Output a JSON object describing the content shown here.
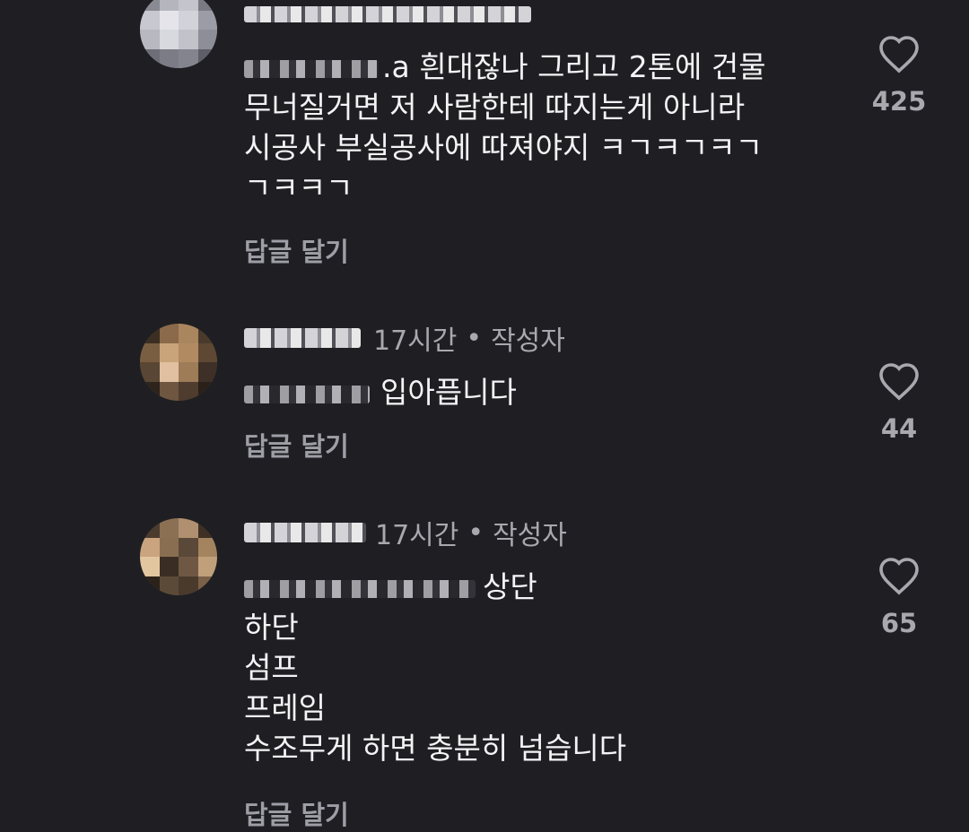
{
  "comments": [
    {
      "meta_time": "",
      "meta_author": "",
      "lines": [
        ".a 흰대잖나 그리고 2톤에 건물",
        "무너질거면 저 사람한테 따지는게 아니라",
        "시공사 부실공사에 따져야지 ㅋㄱㅋㄱㅋㄱ",
        "ㄱㅋㅋㄱ"
      ],
      "reply_label": "답글 달기",
      "like_count": "425"
    },
    {
      "meta_time": "17시간",
      "meta_separator": "•",
      "meta_author": "작성자",
      "lines": [
        "입아픕니다"
      ],
      "reply_label": "답글 달기",
      "like_count": "44"
    },
    {
      "meta_time": "17시간",
      "meta_separator": "•",
      "meta_author": "작성자",
      "lines": [
        "상단",
        "하단",
        "섬프",
        "프레임",
        "수조무게 하면 충분히 넘습니다"
      ],
      "reply_label": "답글 달기",
      "like_count": "65"
    }
  ],
  "icons": {
    "like": "heart-outline-icon"
  },
  "colors": {
    "background": "#1f1f23",
    "text": "#f4f4f6",
    "muted": "#a8a8ae"
  }
}
